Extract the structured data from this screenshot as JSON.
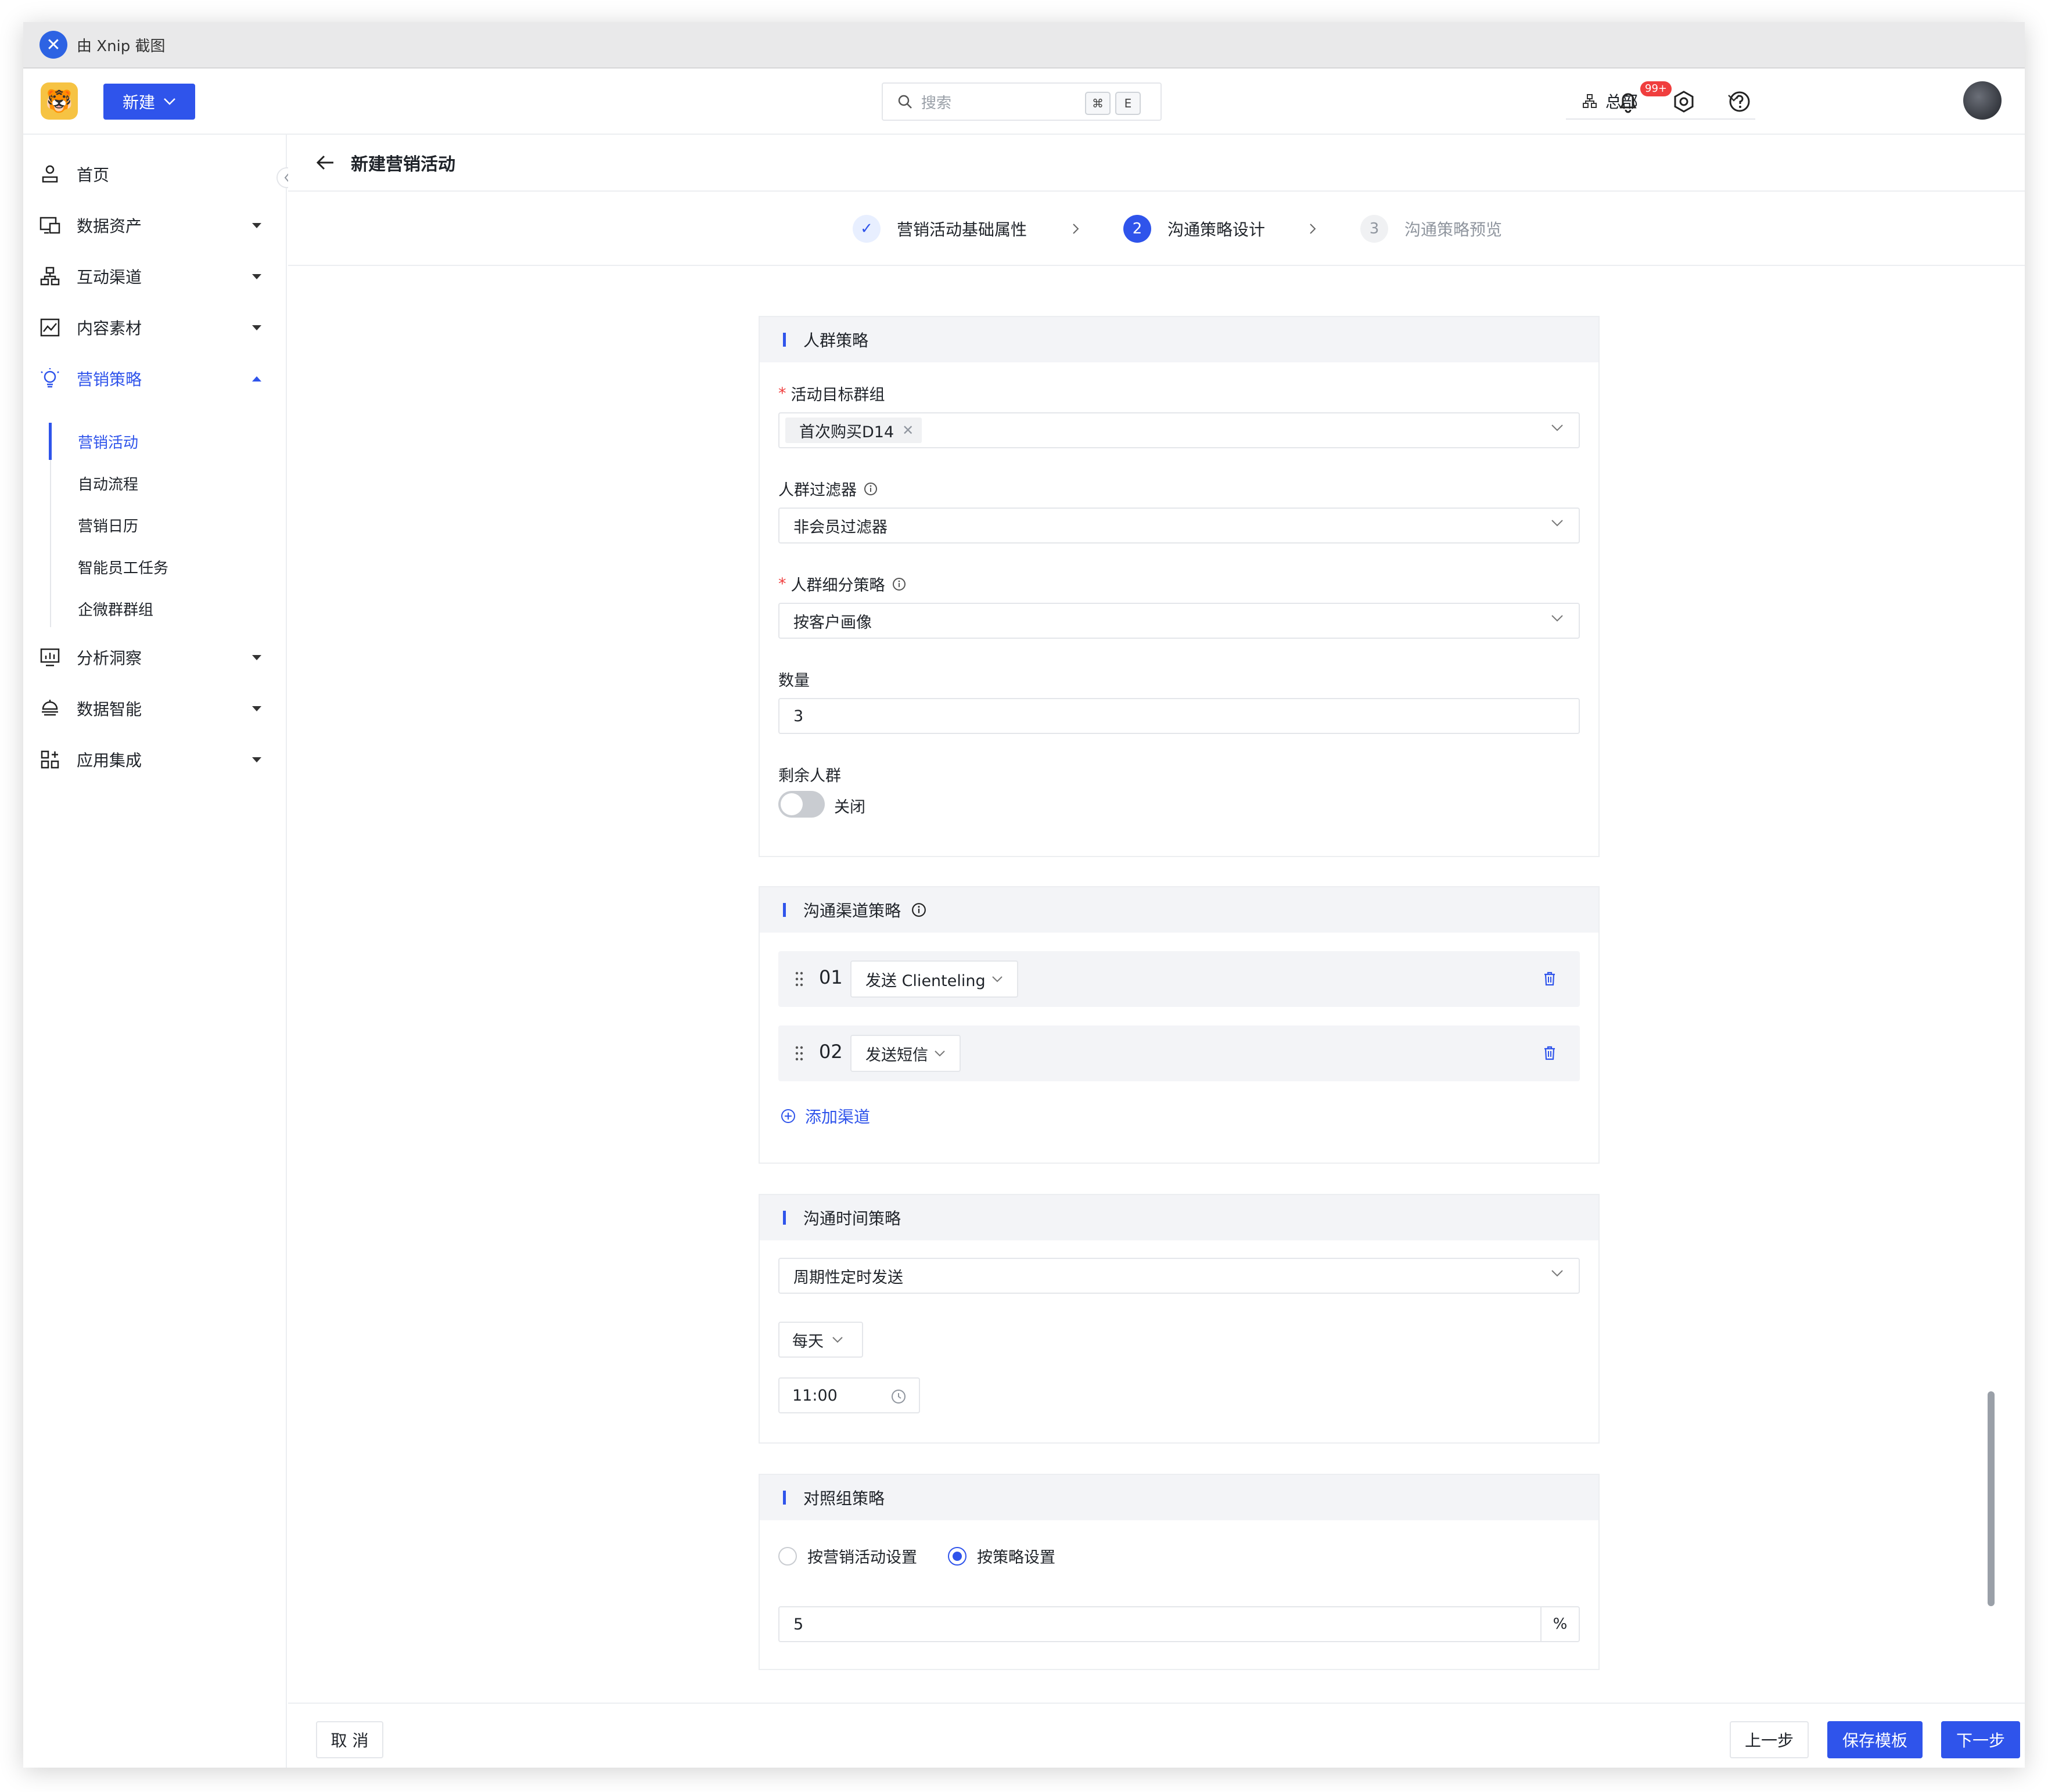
{
  "window": {
    "title": "由 Xnip 截图"
  },
  "topbar": {
    "new_button": "新建",
    "search_placeholder": "搜索",
    "shortcut_key1": "⌘",
    "shortcut_key2": "E",
    "org_selector": "总部",
    "notification_badge": "99+"
  },
  "sidebar": {
    "items": [
      {
        "label": "首页"
      },
      {
        "label": "数据资产"
      },
      {
        "label": "互动渠道"
      },
      {
        "label": "内容素材"
      },
      {
        "label": "营销策略"
      },
      {
        "label": "分析洞察"
      },
      {
        "label": "数据智能"
      },
      {
        "label": "应用集成"
      }
    ],
    "sub_items": [
      {
        "label": "营销活动"
      },
      {
        "label": "自动流程"
      },
      {
        "label": "营销日历"
      },
      {
        "label": "智能员工任务"
      },
      {
        "label": "企微群群组"
      }
    ]
  },
  "page": {
    "title": "新建营销活动"
  },
  "steps": [
    {
      "number": "✓",
      "label": "营销活动基础属性",
      "status": "done"
    },
    {
      "number": "2",
      "label": "沟通策略设计",
      "status": "current"
    },
    {
      "number": "3",
      "label": "沟通策略预览",
      "status": "todo"
    }
  ],
  "audience": {
    "section_title": "人群策略",
    "target_group_label": "活动目标群组",
    "target_group_tag": "首次购买D14",
    "filter_label": "人群过滤器",
    "filter_value": "非会员过滤器",
    "segment_label": "人群细分策略",
    "segment_value": "按客户画像",
    "quantity_label": "数量",
    "quantity_value": "3",
    "remaining_label": "剩余人群",
    "remaining_toggle_label": "关闭"
  },
  "channels": {
    "section_title": "沟通渠道策略",
    "rows": [
      {
        "number": "01",
        "channel": "发送 Clienteling"
      },
      {
        "number": "02",
        "channel": "发送短信"
      }
    ],
    "add_label": "添加渠道"
  },
  "timing": {
    "section_title": "沟通时间策略",
    "mode_value": "周期性定时发送",
    "frequency_value": "每天",
    "time_value": "11:00"
  },
  "control": {
    "section_title": "对照组策略",
    "option_a": "按营销活动设置",
    "option_b": "按策略设置",
    "selected": "按策略设置",
    "percent_value": "5",
    "percent_suffix": "%"
  },
  "footer": {
    "cancel": "取 消",
    "prev": "上一步",
    "save_template": "保存模板",
    "next": "下一步"
  },
  "colors": {
    "primary": "#2f54eb",
    "required": "#f03e3e",
    "badge": "#f03e3e"
  }
}
